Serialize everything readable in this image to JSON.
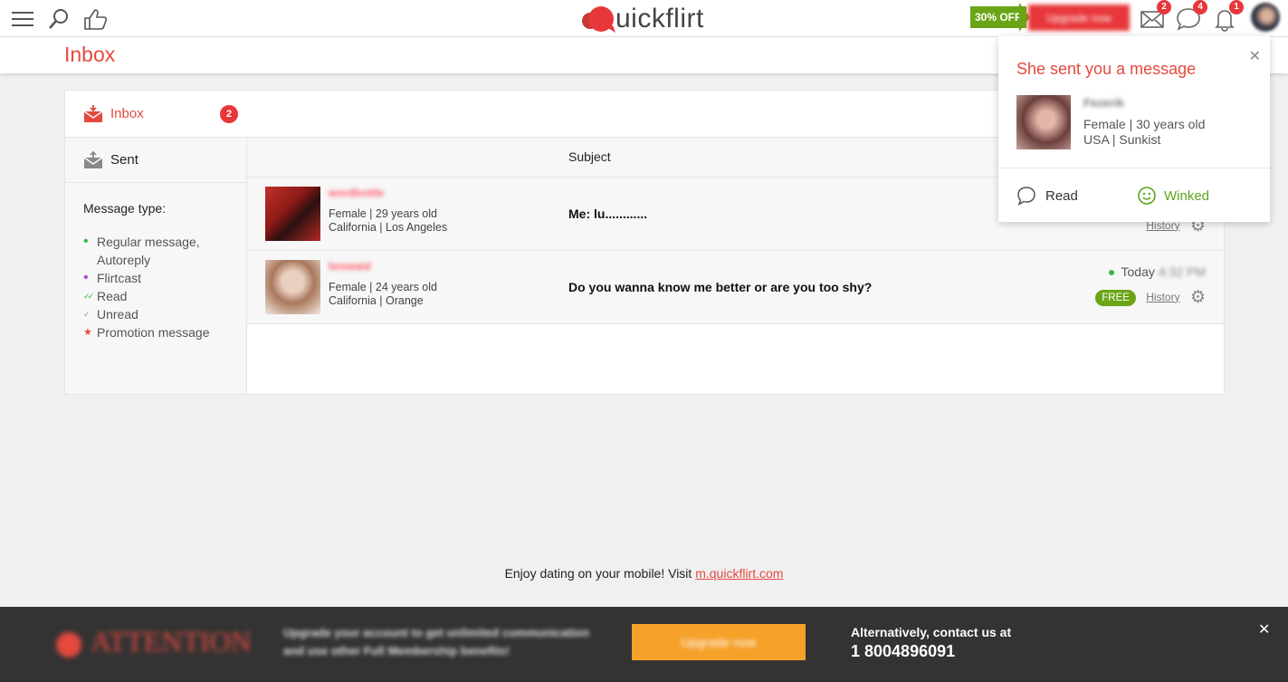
{
  "topbar": {
    "logo_text": "uickflirt",
    "discount_badge": "30% OFF",
    "upgrade_label": "Upgrade now",
    "notifications": {
      "messages_count": "2",
      "chats_count": "4",
      "alerts_count": "1"
    }
  },
  "page": {
    "title": "Inbox"
  },
  "sidebar": {
    "inbox_label": "Inbox",
    "inbox_count": "2",
    "sent_label": "Sent",
    "message_type_title": "Message type:",
    "legend": [
      {
        "label": "Regular message, Autoreply",
        "marker": "•",
        "color": "#3bb543"
      },
      {
        "label": "Flirtcast",
        "marker": "•",
        "color": "#a64dd6"
      },
      {
        "label": "Read",
        "marker": "✓✓",
        "color": "#3bb543"
      },
      {
        "label": "Unread",
        "marker": "✓",
        "color": "#999999"
      },
      {
        "label": "Promotion message",
        "marker": "★",
        "color": "#e4493f"
      }
    ]
  },
  "list": {
    "subject_header": "Subject",
    "rows": [
      {
        "username": "wordbottle",
        "gender_age": "Female | 29 years old",
        "location": "California | Los Angeles",
        "message": "Me: lu............",
        "history_label": "History"
      },
      {
        "username": "leiswaid",
        "gender_age": "Female | 24 years old",
        "location": "California | Orange",
        "message": "Do you wanna know me better or are you too shy?",
        "date": "Today",
        "time": "4:32 PM",
        "free_badge": "FREE",
        "history_label": "History"
      }
    ]
  },
  "popup": {
    "title": "She sent you a message",
    "username": "Fezerik",
    "gender_age": "Female | 30 years old",
    "location": "USA | Sunkist",
    "read_label": "Read",
    "winked_label": "Winked"
  },
  "footer": {
    "text": "Enjoy dating on your mobile! Visit ",
    "link": "m.quickflirt.com"
  },
  "attention": {
    "title": "ATTENTION",
    "description": "Upgrade your account to get unlimited communication and use other Full Membership benefits!",
    "button_label": "Upgrade now",
    "alt_text": "Alternatively, contact us at",
    "phone": "1 8004896091"
  },
  "colors": {
    "accent": "#e4493f",
    "green": "#6aa516",
    "orange": "#f5a12a"
  }
}
